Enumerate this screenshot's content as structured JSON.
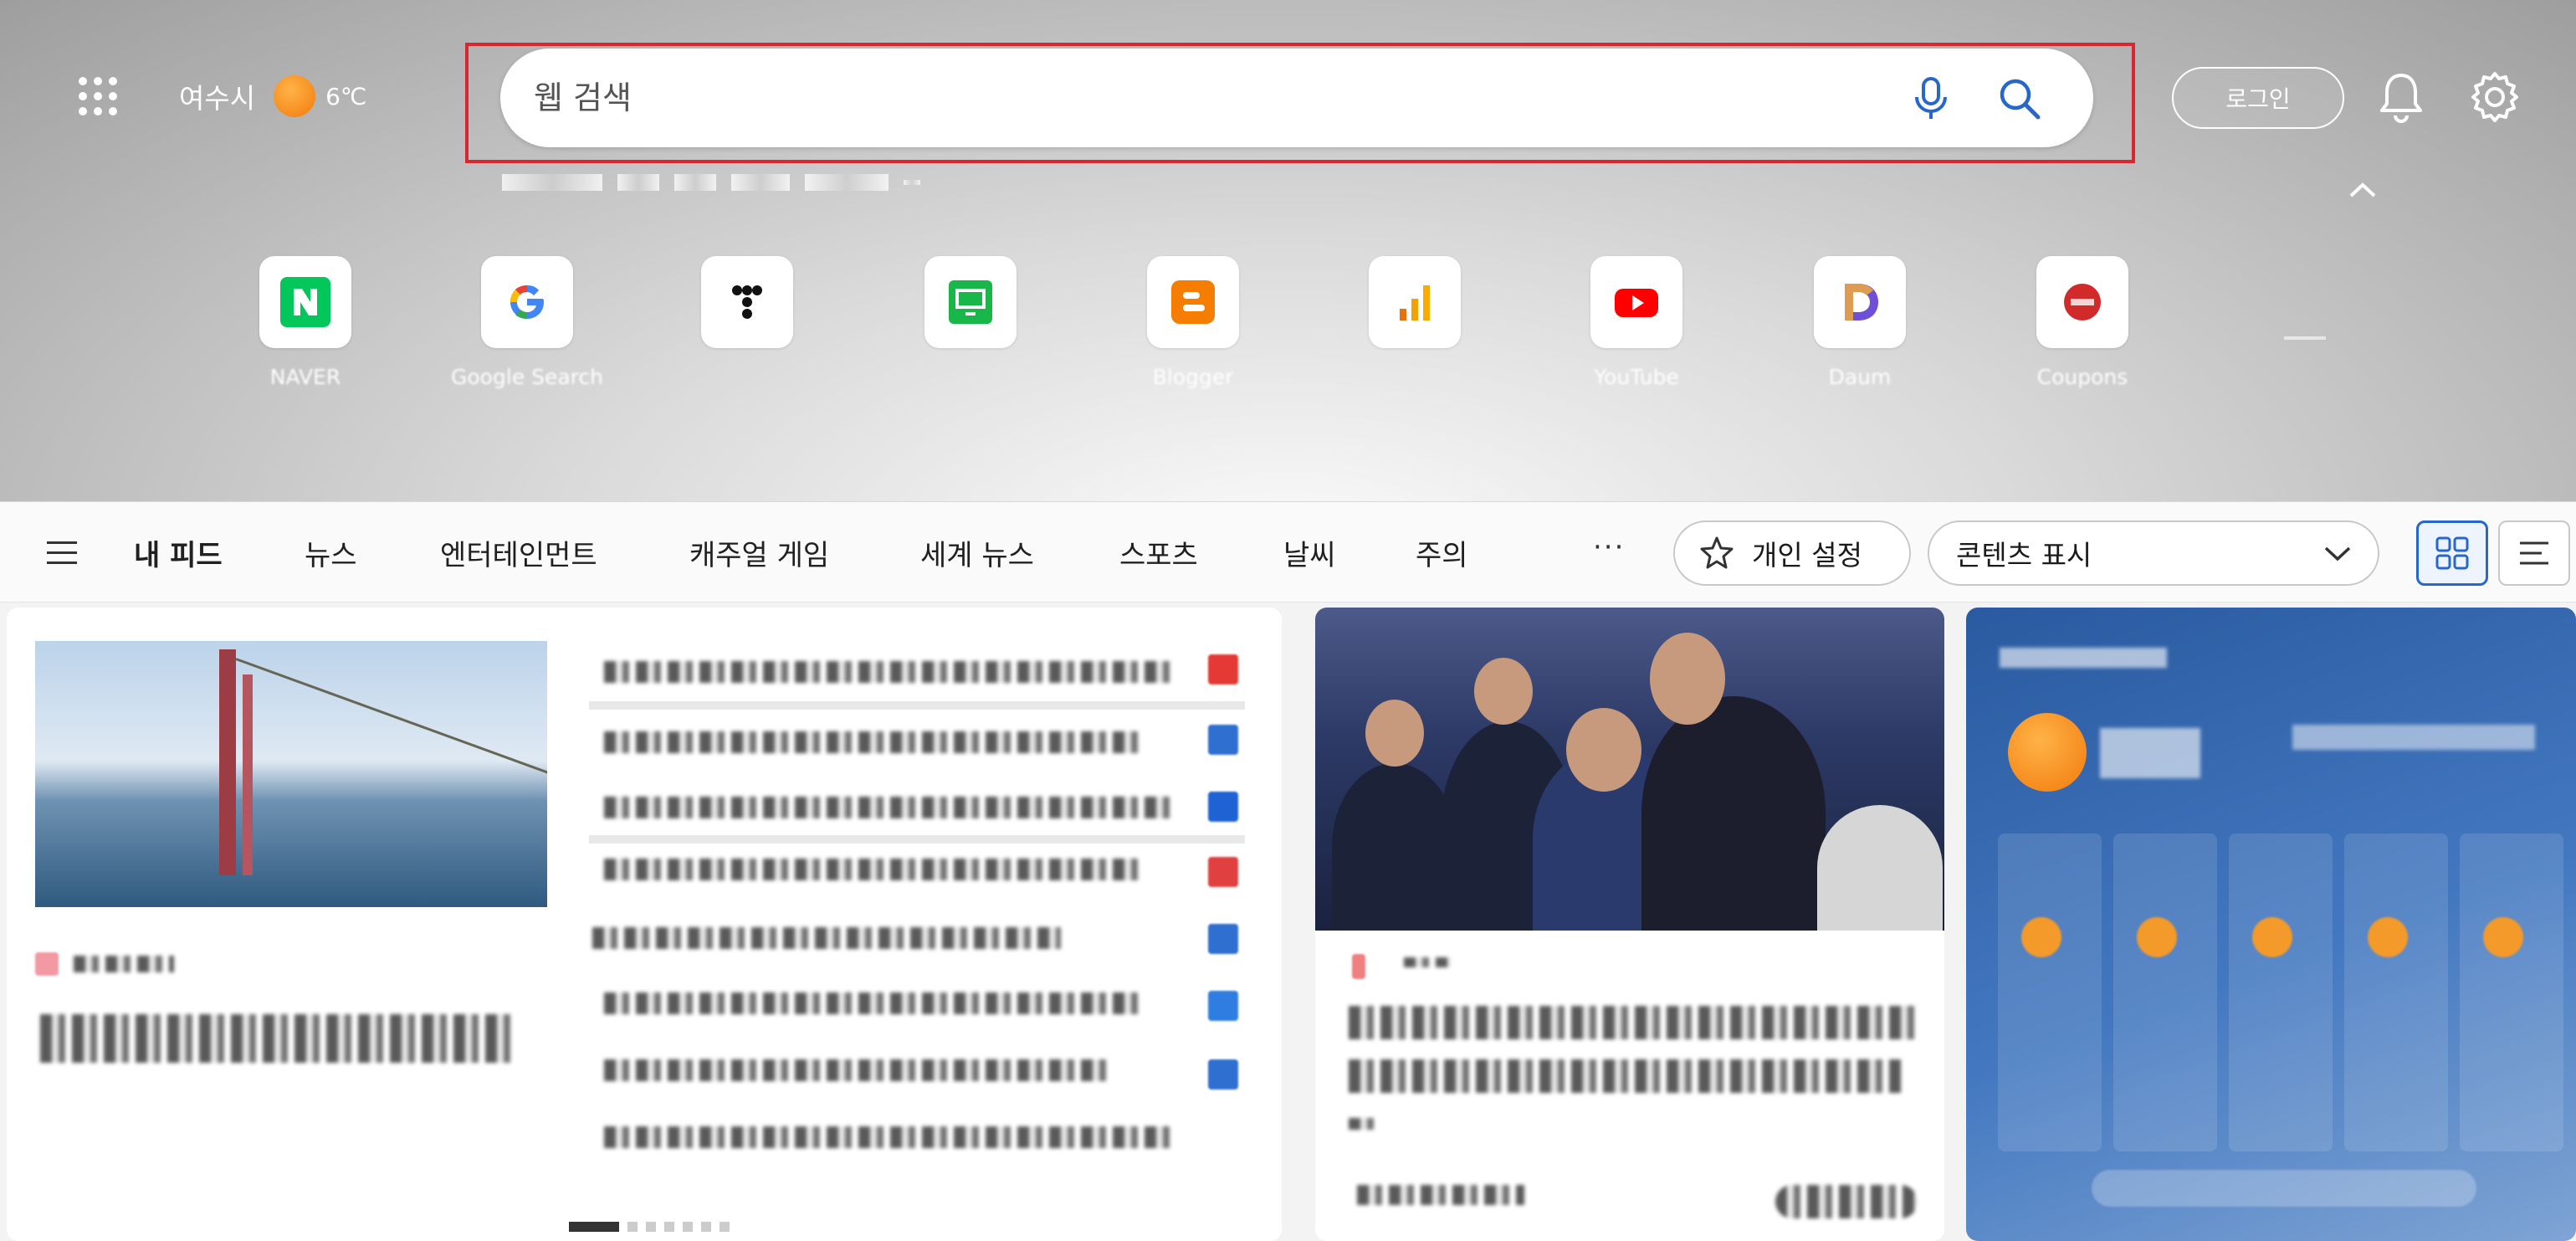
{
  "header": {
    "location": "여수시",
    "temperature": "6",
    "temperature_unit": "℃",
    "weather_icon": "sun-icon",
    "login_label": "로그인"
  },
  "search": {
    "placeholder": "웹 검색"
  },
  "shortcuts": [
    {
      "label": "NAVER",
      "icon": "naver-icon",
      "color": "#03c75a"
    },
    {
      "label": "Google Search",
      "icon": "google-icon",
      "color": "#4285f4"
    },
    {
      "label": "",
      "icon": "tistory-icon",
      "color": "#000000"
    },
    {
      "label": "",
      "icon": "monitor-app-icon",
      "color": "#19b74a"
    },
    {
      "label": "Blogger",
      "icon": "blogger-icon",
      "color": "#f57d00"
    },
    {
      "label": "",
      "icon": "analytics-icon",
      "color": "#f4a100"
    },
    {
      "label": "YouTube",
      "icon": "youtube-icon",
      "color": "#ff0000"
    },
    {
      "label": "Daum",
      "icon": "daum-icon",
      "color": "#6e4fd8"
    },
    {
      "label": "Coupons",
      "icon": "coupons-icon",
      "color": "#d02a2a"
    }
  ],
  "nav": {
    "items": [
      "내 피드",
      "뉴스",
      "엔터테인먼트",
      "캐주얼 게임",
      "세계 뉴스",
      "스포츠",
      "날씨",
      "주의"
    ],
    "more_label": "···",
    "personalize_label": "개인 설정",
    "content_display_label": "콘텐츠 표시"
  }
}
